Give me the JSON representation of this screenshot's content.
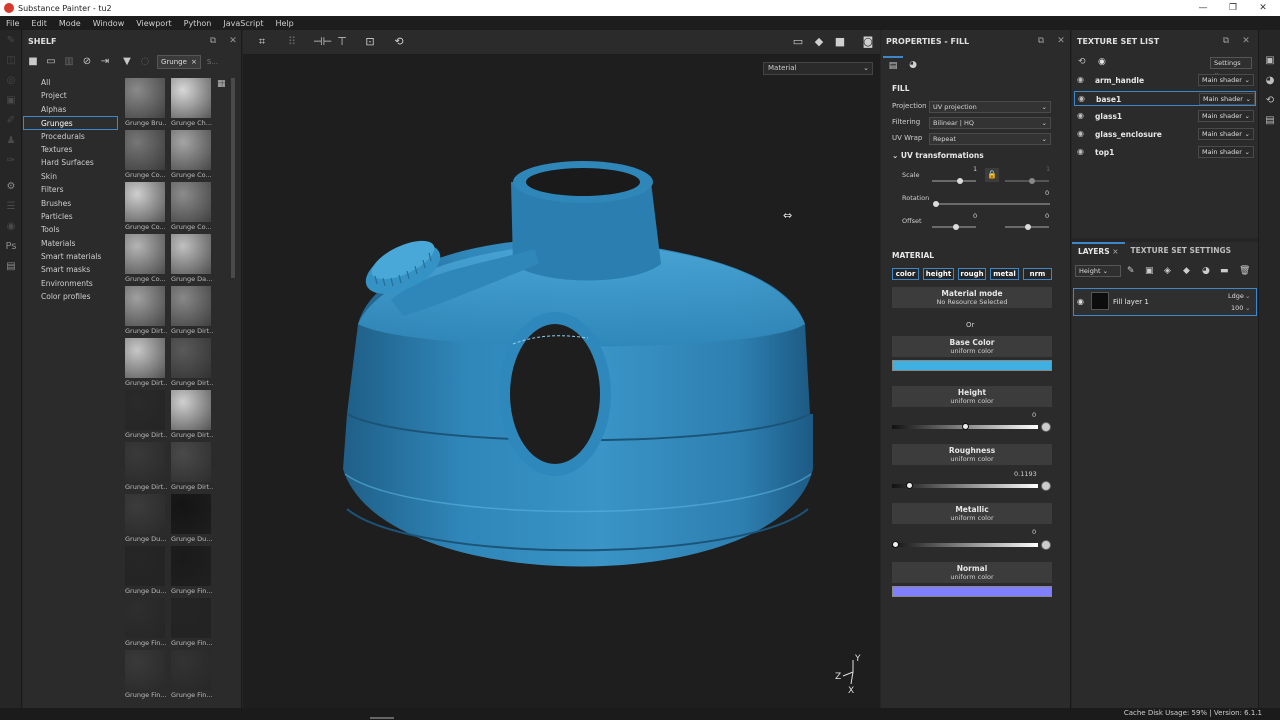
{
  "window": {
    "title": "Substance Painter - tu2"
  },
  "menu": [
    "File",
    "Edit",
    "Mode",
    "Window",
    "Viewport",
    "Python",
    "JavaScript",
    "Help"
  ],
  "shelf": {
    "title": "SHELF",
    "search_chip": "Grunge",
    "search_chip_close": "×",
    "search_placeholder": "S...",
    "categories": [
      "All",
      "Project",
      "Alphas",
      "Grunges",
      "Procedurals",
      "Textures",
      "Hard Surfaces",
      "Skin",
      "Filters",
      "Brushes",
      "Particles",
      "Tools",
      "Materials",
      "Smart materials",
      "Smart masks",
      "Environments",
      "Color profiles"
    ],
    "active_category": "Grunges",
    "thumbnails": [
      {
        "label": "Grunge Bru...",
        "color": "#8a8a8a"
      },
      {
        "label": "Grunge Ch...",
        "color": "#d8d8d8"
      },
      {
        "label": "Grunge Co...",
        "color": "#777777"
      },
      {
        "label": "Grunge Co...",
        "color": "#a5a5a5"
      },
      {
        "label": "Grunge Co...",
        "color": "#cfcfcf"
      },
      {
        "label": "Grunge Co...",
        "color": "#8c8c8c"
      },
      {
        "label": "Grunge Co...",
        "color": "#b5b5b5"
      },
      {
        "label": "Grunge Da...",
        "color": "#c0c0c0"
      },
      {
        "label": "Grunge Dirt...",
        "color": "#a0a0a0"
      },
      {
        "label": "Grunge Dirt...",
        "color": "#888888"
      },
      {
        "label": "Grunge Dirt...",
        "color": "#c8c8c8"
      },
      {
        "label": "Grunge Dirt...",
        "color": "#5a5a5a"
      },
      {
        "label": "Grunge Dirt...",
        "color": "#2a2a2a"
      },
      {
        "label": "Grunge Dirt...",
        "color": "#d0d0d0"
      },
      {
        "label": "Grunge Dirt...",
        "color": "#3a3a3a"
      },
      {
        "label": "Grunge Dirt...",
        "color": "#4a4a4a"
      },
      {
        "label": "Grunge Du...",
        "color": "#3c3c3c"
      },
      {
        "label": "Grunge Du...",
        "color": "#141414"
      },
      {
        "label": "Grunge Du...",
        "color": "#262626"
      },
      {
        "label": "Grunge Fin...",
        "color": "#1a1a1a"
      },
      {
        "label": "Grunge Fin...",
        "color": "#2e2e2e"
      },
      {
        "label": "Grunge Fin...",
        "color": "#242424"
      },
      {
        "label": "Grunge Fin...",
        "color": "#3a3a3a"
      },
      {
        "label": "Grunge Fin...",
        "color": "#333333"
      }
    ]
  },
  "viewport": {
    "display_mode": "Material",
    "axis_labels": [
      "Y",
      "Z",
      "X"
    ]
  },
  "properties": {
    "title": "PROPERTIES - FILL",
    "fill_title": "FILL",
    "projection_label": "Projection",
    "projection_value": "UV projection",
    "filtering_label": "Filtering",
    "filtering_value": "Bilinear | HQ",
    "uvwrap_label": "UV Wrap",
    "uvwrap_value": "Repeat",
    "uv_transform_title": "UV transformations",
    "scale_label": "Scale",
    "scale_value_a": "1",
    "scale_value_b": "1",
    "rotation_label": "Rotation",
    "rotation_value": "0",
    "offset_label": "Offset",
    "offset_value_a": "0",
    "offset_value_b": "0",
    "material_title": "MATERIAL",
    "channels": [
      "color",
      "height",
      "rough",
      "metal",
      "nrm"
    ],
    "material_mode_title": "Material mode",
    "material_mode_sub": "No Resource Selected",
    "or_text": "Or",
    "base_color_title": "Base Color",
    "base_color_sub": "uniform color",
    "base_color_hex": "#3fb0e0",
    "height_title": "Height",
    "height_sub": "uniform color",
    "height_value": "0",
    "roughness_title": "Roughness",
    "roughness_sub": "uniform color",
    "roughness_value": "0.1193",
    "metallic_title": "Metallic",
    "metallic_sub": "uniform color",
    "metallic_value": "0",
    "normal_title": "Normal",
    "normal_sub": "uniform color",
    "normal_hex": "#8080ff"
  },
  "texture_set_list": {
    "title": "TEXTURE SET LIST",
    "settings_label": "Settings",
    "rows": [
      {
        "name": "arm_handle",
        "shader": "Main shader"
      },
      {
        "name": "base1",
        "shader": "Main shader"
      },
      {
        "name": "glass1",
        "shader": "Main shader"
      },
      {
        "name": "glass_enclosure",
        "shader": "Main shader"
      },
      {
        "name": "top1",
        "shader": "Main shader"
      }
    ],
    "active_row": "base1"
  },
  "layers": {
    "tab_layers": "LAYERS",
    "tab_close": "×",
    "tab_tss": "TEXTURE SET SETTINGS",
    "channel_select": "Height",
    "layer_name": "Fill layer 1",
    "blend_mode": "Ldge",
    "opacity": "100"
  },
  "status": {
    "text": "Cache Disk Usage:  59% | Version: 6.1.1"
  },
  "colors": {
    "accent": "#3e87c9",
    "model": "#2f7fb0"
  }
}
